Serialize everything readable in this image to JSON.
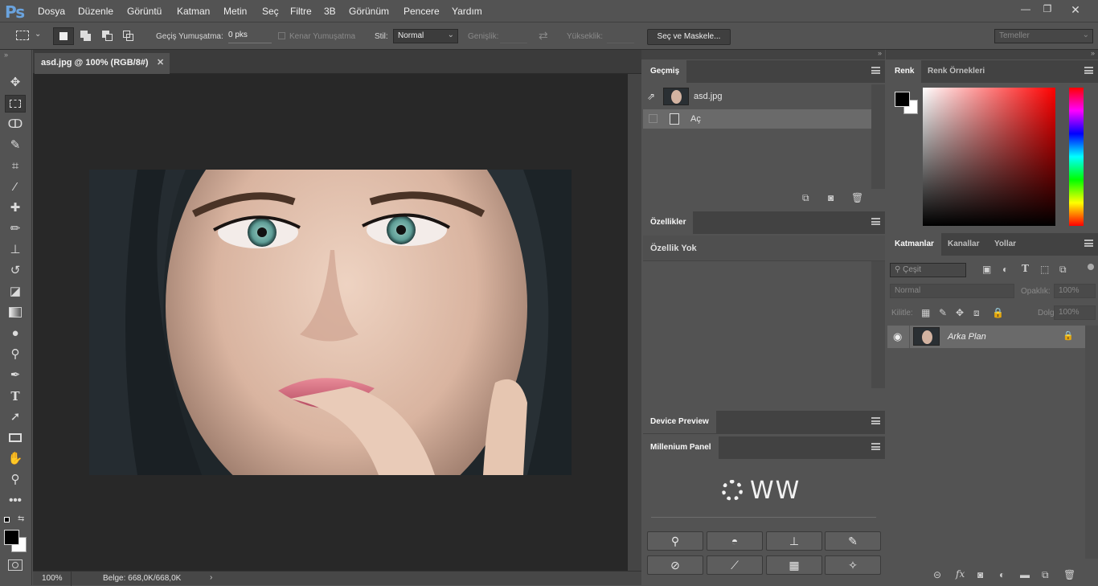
{
  "app": {
    "logo": "Ps"
  },
  "menu": [
    "Dosya",
    "Düzenle",
    "Görüntü",
    "Katman",
    "Metin",
    "Seç",
    "Filtre",
    "3B",
    "Görünüm",
    "Pencere",
    "Yardım"
  ],
  "window_controls": {
    "minimize": "—",
    "restore": "❐",
    "close": "✕"
  },
  "options": {
    "feather_label": "Geçiş Yumuşatma:",
    "feather_value": "0 pks",
    "antialias_label": "Kenar Yumuşatma",
    "style_label": "Stil:",
    "style_value": "Normal",
    "width_label": "Genişlik:",
    "height_label": "Yükseklik:",
    "select_mask_button": "Seç ve Maskele...",
    "workspace": "Temeller"
  },
  "document": {
    "tab_title": "asd.jpg @ 100% (RGB/8#)",
    "zoom": "100%",
    "doc_info": "Belge: 668,0K/668,0K"
  },
  "history": {
    "tab": "Geçmiş",
    "snapshot_name": "asd.jpg",
    "items": [
      {
        "label": "Aç"
      }
    ]
  },
  "properties": {
    "tab": "Özellikler",
    "empty_text": "Özellik Yok"
  },
  "device_preview": {
    "tab": "Device Preview"
  },
  "millenium": {
    "tab": "Millenium Panel",
    "logo_text": "WW"
  },
  "color": {
    "tabs": [
      "Renk",
      "Renk Örnekleri"
    ],
    "foreground": "#000000",
    "background": "#ffffff",
    "hue_color": "#ff0000"
  },
  "layers": {
    "tabs": [
      "Katmanlar",
      "Kanallar",
      "Yollar"
    ],
    "filter_placeholder": "Çeşit",
    "blend_mode": "Normal",
    "opacity_label": "Opaklık:",
    "opacity_value": "100%",
    "lock_label": "Kilitle:",
    "fill_label": "Dolgu:",
    "fill_value": "100%",
    "items": [
      {
        "name": "Arka Plan",
        "locked": true
      }
    ]
  },
  "colors": {
    "ui_bg": "#535353",
    "panel_header": "#424242",
    "canvas_bg": "#282828",
    "accent_blue": "#6aa3de"
  }
}
